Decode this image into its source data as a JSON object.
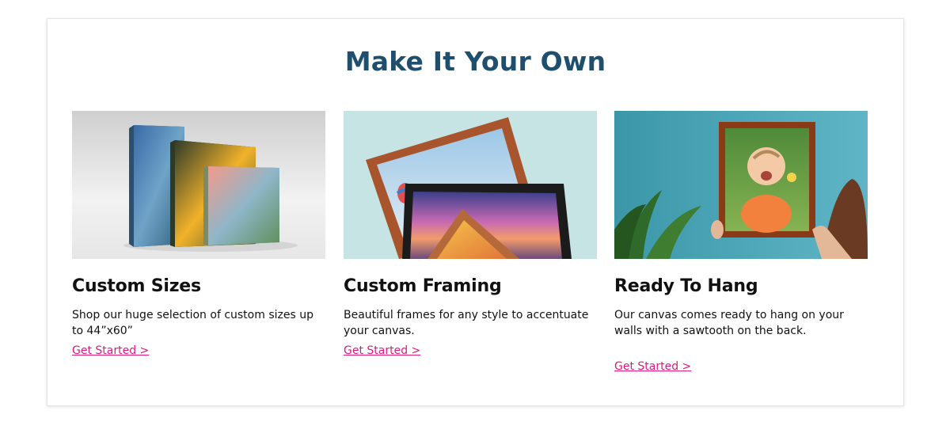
{
  "section": {
    "title": "Make It Your Own",
    "title_color": "#1e4f6f",
    "link_color": "#e0197d"
  },
  "cards": [
    {
      "title": "Custom Sizes",
      "text": "Shop our huge selection of custom sizes up to 44”x60”",
      "link": "Get Started >"
    },
    {
      "title": "Custom Framing",
      "text": "Beautiful frames for any style to accentuate your canvas.",
      "link": "Get Started >"
    },
    {
      "title": "Ready To Hang",
      "text": "Our canvas comes ready to hang on your walls with a sawtooth on the back.",
      "link": "Get Started >"
    }
  ]
}
